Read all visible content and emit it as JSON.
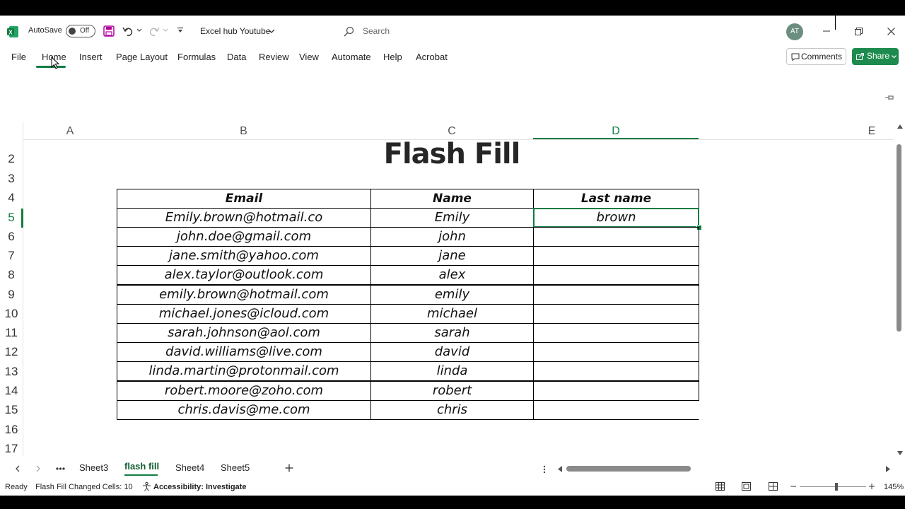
{
  "titlebar": {
    "autosave_label": "AutoSave",
    "autosave_state": "Off",
    "filename": "Excel hub Youtube",
    "search_placeholder": "Search",
    "avatar": "AT"
  },
  "menu": [
    "File",
    "Home",
    "Insert",
    "Page Layout",
    "Formulas",
    "Data",
    "Review",
    "View",
    "Automate",
    "Help",
    "Acrobat"
  ],
  "actions": {
    "comments": "Comments",
    "share": "Share"
  },
  "columns": [
    "A",
    "B",
    "C",
    "D",
    "E"
  ],
  "rows": [
    "2",
    "3",
    "4",
    "5",
    "6",
    "7",
    "8",
    "9",
    "10",
    "11",
    "12",
    "13",
    "14",
    "15",
    "16",
    "17"
  ],
  "sheet": {
    "title": "Flash Fill",
    "headers": [
      "Email",
      "Name",
      "Last name"
    ],
    "data": [
      [
        "Emily.brown@hotmail.co",
        "Emily",
        "brown"
      ],
      [
        "john.doe@gmail.com",
        "john",
        ""
      ],
      [
        "jane.smith@yahoo.com",
        "jane",
        ""
      ],
      [
        "alex.taylor@outlook.com",
        "alex",
        ""
      ],
      [
        "emily.brown@hotmail.com",
        "emily",
        ""
      ],
      [
        "michael.jones@icloud.com",
        "michael",
        ""
      ],
      [
        "sarah.johnson@aol.com",
        "sarah",
        ""
      ],
      [
        "david.williams@live.com",
        "david",
        ""
      ],
      [
        "linda.martin@protonmail.com",
        "linda",
        ""
      ],
      [
        "robert.moore@zoho.com",
        "robert",
        ""
      ],
      [
        "chris.davis@me.com",
        "chris",
        ""
      ]
    ]
  },
  "tabs": {
    "items": [
      "Sheet3",
      "flash fill",
      "Sheet4",
      "Sheet5"
    ],
    "active": "flash fill"
  },
  "status": {
    "ready": "Ready",
    "flash": "Flash Fill Changed Cells: 10",
    "accessibility": "Accessibility: Investigate",
    "zoom": "145%"
  },
  "colors": {
    "excel_green": "#107c41",
    "share_green": "#1e8b4e",
    "grid": "#000000"
  }
}
